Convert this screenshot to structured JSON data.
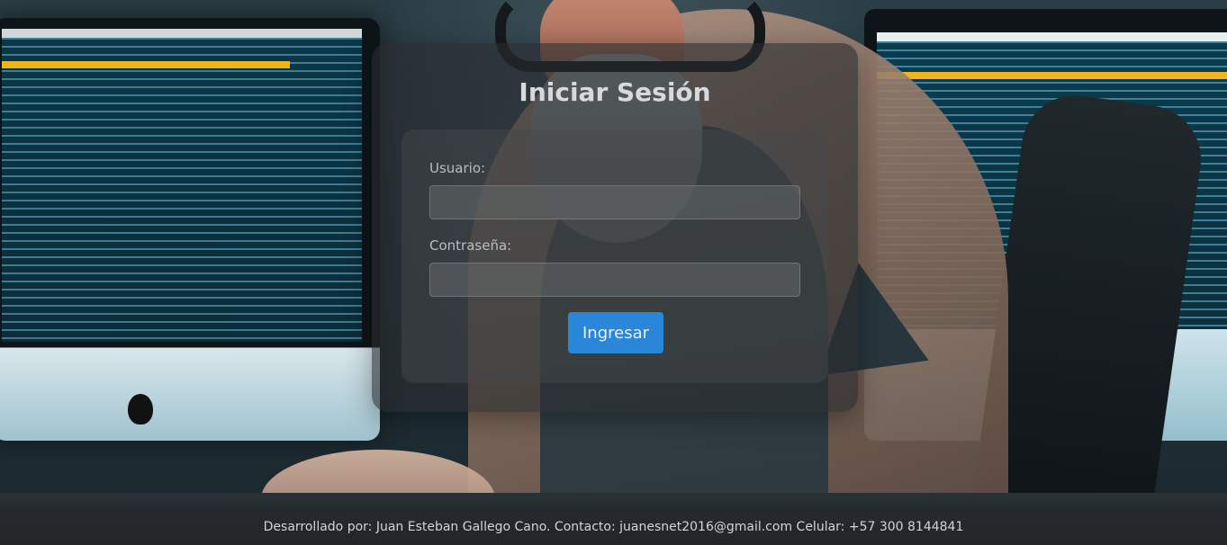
{
  "login": {
    "title": "Iniciar Sesión",
    "username_label": "Usuario:",
    "username_value": "",
    "password_label": "Contraseña:",
    "password_value": "",
    "submit_label": "Ingresar"
  },
  "footer": {
    "text": "Desarrollado por: Juan Esteban Gallego Cano. Contacto: juanesnet2016@gmail.com Celular: +57 300 8144841"
  },
  "colors": {
    "button_bg": "#2a86d8",
    "panel_bg": "rgba(40,44,46,0.62)"
  }
}
